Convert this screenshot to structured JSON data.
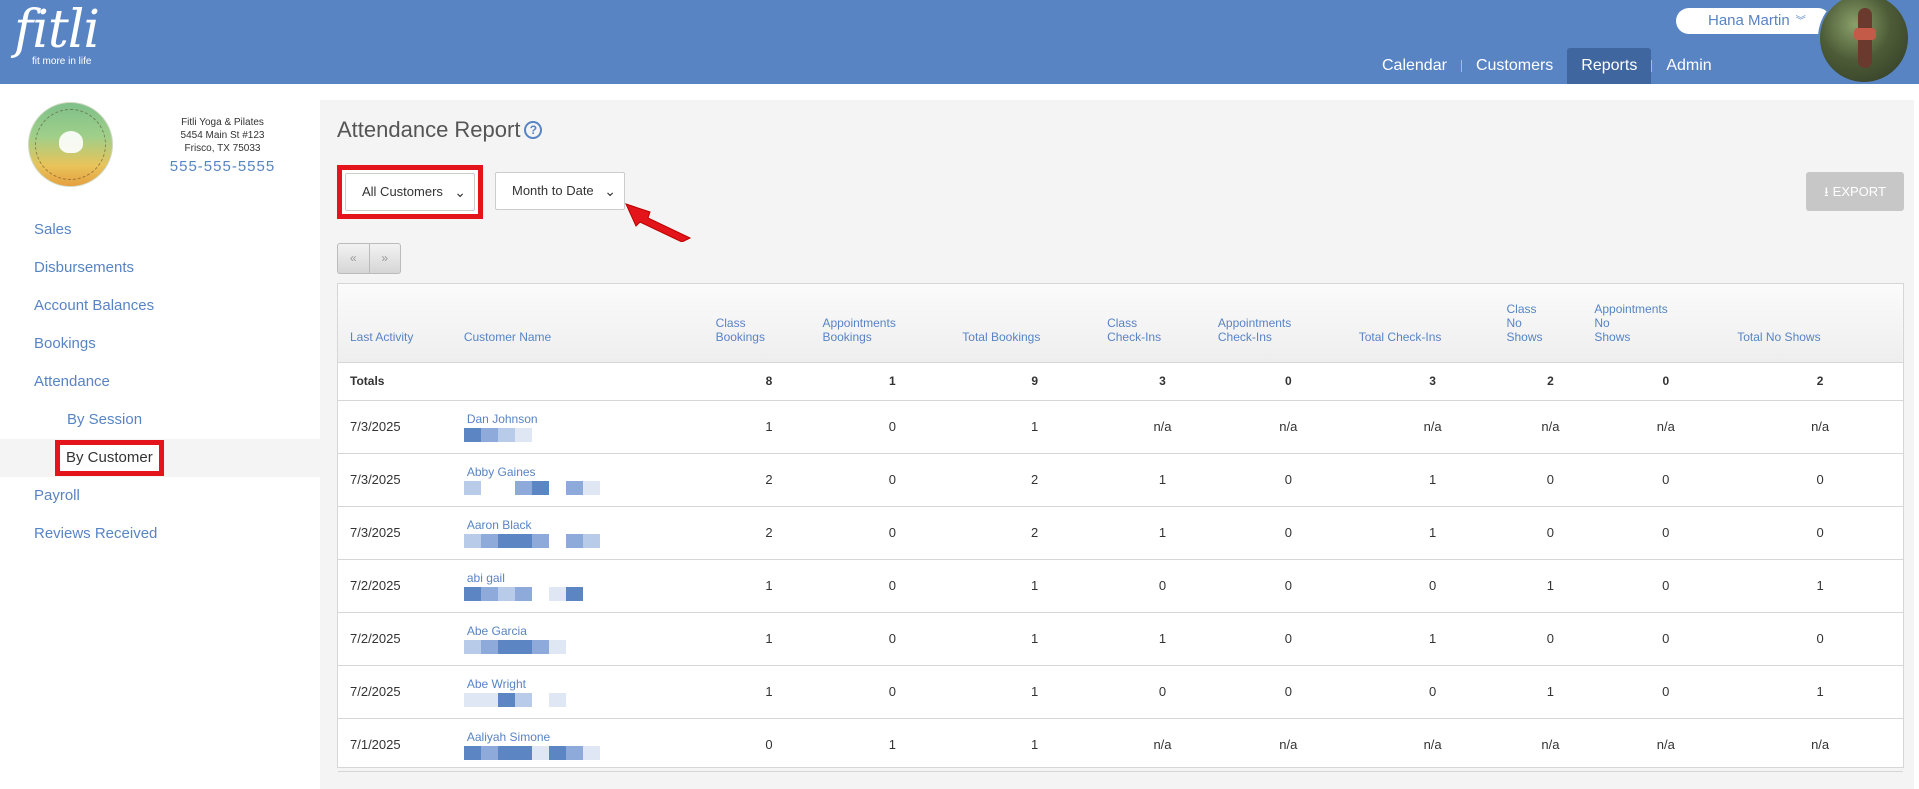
{
  "header": {
    "logo_text": "fitli",
    "logo_tagline": "fit more in life",
    "user_name": "Hana Martin",
    "nav": [
      {
        "label": "Calendar",
        "active": false
      },
      {
        "label": "Customers",
        "active": false
      },
      {
        "label": "Reports",
        "active": true
      },
      {
        "label": "Admin",
        "active": false
      }
    ]
  },
  "studio": {
    "name": "Fitli Yoga & Pilates",
    "address1": "5454 Main St #123",
    "address2": "Frisco, TX 75033",
    "phone": "555-555-5555"
  },
  "sidebar": {
    "items": [
      {
        "label": "Sales"
      },
      {
        "label": "Disbursements"
      },
      {
        "label": "Account Balances"
      },
      {
        "label": "Bookings"
      },
      {
        "label": "Attendance"
      }
    ],
    "sub_items": [
      {
        "label": "By Session"
      },
      {
        "label": "By Customer"
      }
    ],
    "after_items": [
      {
        "label": "Payroll"
      },
      {
        "label": "Reviews Received"
      }
    ]
  },
  "report": {
    "title": "Attendance Report",
    "help_glyph": "?",
    "customer_filter": "All Customers",
    "date_filter": "Month to Date",
    "export_label": "EXPORT",
    "pager_prev": "«",
    "pager_next": "»",
    "columns": [
      [
        "Last Activity"
      ],
      [
        "Customer Name"
      ],
      [
        "Class",
        "Bookings"
      ],
      [
        "Appointments",
        "Bookings"
      ],
      [
        "Total Bookings"
      ],
      [
        "Class",
        "Check-Ins"
      ],
      [
        "Appointments",
        "Check-Ins"
      ],
      [
        "Total Check-Ins"
      ],
      [
        "Class",
        "No",
        "Shows"
      ],
      [
        "Appointments",
        "No",
        "Shows"
      ],
      [
        "Total No Shows"
      ]
    ],
    "totals": {
      "label": "Totals",
      "values": [
        "8",
        "1",
        "9",
        "3",
        "0",
        "3",
        "2",
        "0",
        "2"
      ]
    },
    "rows": [
      {
        "date": "7/3/2025",
        "name": "Dan Johnson",
        "values": [
          "1",
          "0",
          "1",
          "n/a",
          "n/a",
          "n/a",
          "n/a",
          "n/a",
          "n/a"
        ]
      },
      {
        "date": "7/3/2025",
        "name": "Abby Gaines",
        "values": [
          "2",
          "0",
          "2",
          "1",
          "0",
          "1",
          "0",
          "0",
          "0"
        ]
      },
      {
        "date": "7/3/2025",
        "name": "Aaron Black",
        "values": [
          "2",
          "0",
          "2",
          "1",
          "0",
          "1",
          "0",
          "0",
          "0"
        ]
      },
      {
        "date": "7/2/2025",
        "name": "abi gail",
        "values": [
          "1",
          "0",
          "1",
          "0",
          "0",
          "0",
          "1",
          "0",
          "1"
        ]
      },
      {
        "date": "7/2/2025",
        "name": "Abe Garcia",
        "values": [
          "1",
          "0",
          "1",
          "1",
          "0",
          "1",
          "0",
          "0",
          "0"
        ]
      },
      {
        "date": "7/2/2025",
        "name": "Abe Wright",
        "values": [
          "1",
          "0",
          "1",
          "0",
          "0",
          "0",
          "1",
          "0",
          "1"
        ]
      },
      {
        "date": "7/1/2025",
        "name": "Aaliyah Simone",
        "values": [
          "0",
          "1",
          "1",
          "n/a",
          "n/a",
          "n/a",
          "n/a",
          "n/a",
          "n/a"
        ]
      }
    ]
  },
  "colors": {
    "header_bg": "#5884c4",
    "nav_active": "#3f669f",
    "link": "#5884c4",
    "highlight": "#e3151a",
    "export_disabled": "#c7c7c7"
  }
}
